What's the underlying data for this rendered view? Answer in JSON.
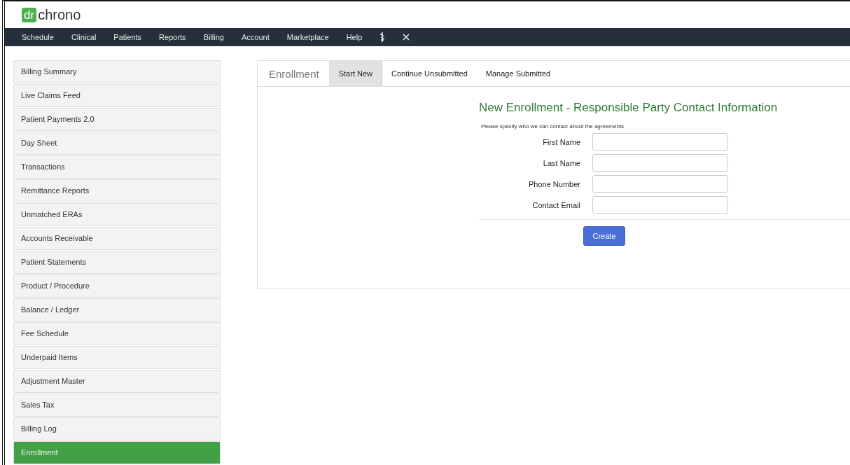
{
  "logo": {
    "mark": "dr",
    "name": "chrono"
  },
  "nav": [
    {
      "label": "Schedule"
    },
    {
      "label": "Clinical"
    },
    {
      "label": "Patients"
    },
    {
      "label": "Reports"
    },
    {
      "label": "Billing"
    },
    {
      "label": "Account"
    },
    {
      "label": "Marketplace"
    },
    {
      "label": "Help"
    }
  ],
  "sidebar": {
    "items": [
      {
        "label": "Billing Summary",
        "selected": false
      },
      {
        "label": "Live Claims Feed",
        "selected": false
      },
      {
        "label": "Patient Payments 2.0",
        "selected": false
      },
      {
        "label": "Day Sheet",
        "selected": false
      },
      {
        "label": "Transactions",
        "selected": false
      },
      {
        "label": "Remittance Reports",
        "selected": false
      },
      {
        "label": "Unmatched ERAs",
        "selected": false
      },
      {
        "label": "Accounts Receivable",
        "selected": false
      },
      {
        "label": "Patient Statements",
        "selected": false
      },
      {
        "label": "Product / Procedure",
        "selected": false
      },
      {
        "label": "Balance / Ledger",
        "selected": false
      },
      {
        "label": "Fee Schedule",
        "selected": false
      },
      {
        "label": "Underpaid Items",
        "selected": false
      },
      {
        "label": "Adjustment Master",
        "selected": false
      },
      {
        "label": "Sales Tax",
        "selected": false
      },
      {
        "label": "Billing Log",
        "selected": false
      },
      {
        "label": "Enrollment",
        "selected": true
      }
    ]
  },
  "panel": {
    "heading": "Enrollment",
    "tabs": [
      {
        "label": "Start New",
        "selected": true
      },
      {
        "label": "Continue Unsubmitted",
        "selected": false
      },
      {
        "label": "Manage Submitted",
        "selected": false
      }
    ],
    "form": {
      "title": "New Enrollment - Responsible Party Contact Information",
      "description": "Please specify who we can contact about the agreements",
      "fields": [
        {
          "label": "First Name"
        },
        {
          "label": "Last Name"
        },
        {
          "label": "Phone Number"
        },
        {
          "label": "Contact Email"
        }
      ],
      "submit": "Create"
    }
  }
}
